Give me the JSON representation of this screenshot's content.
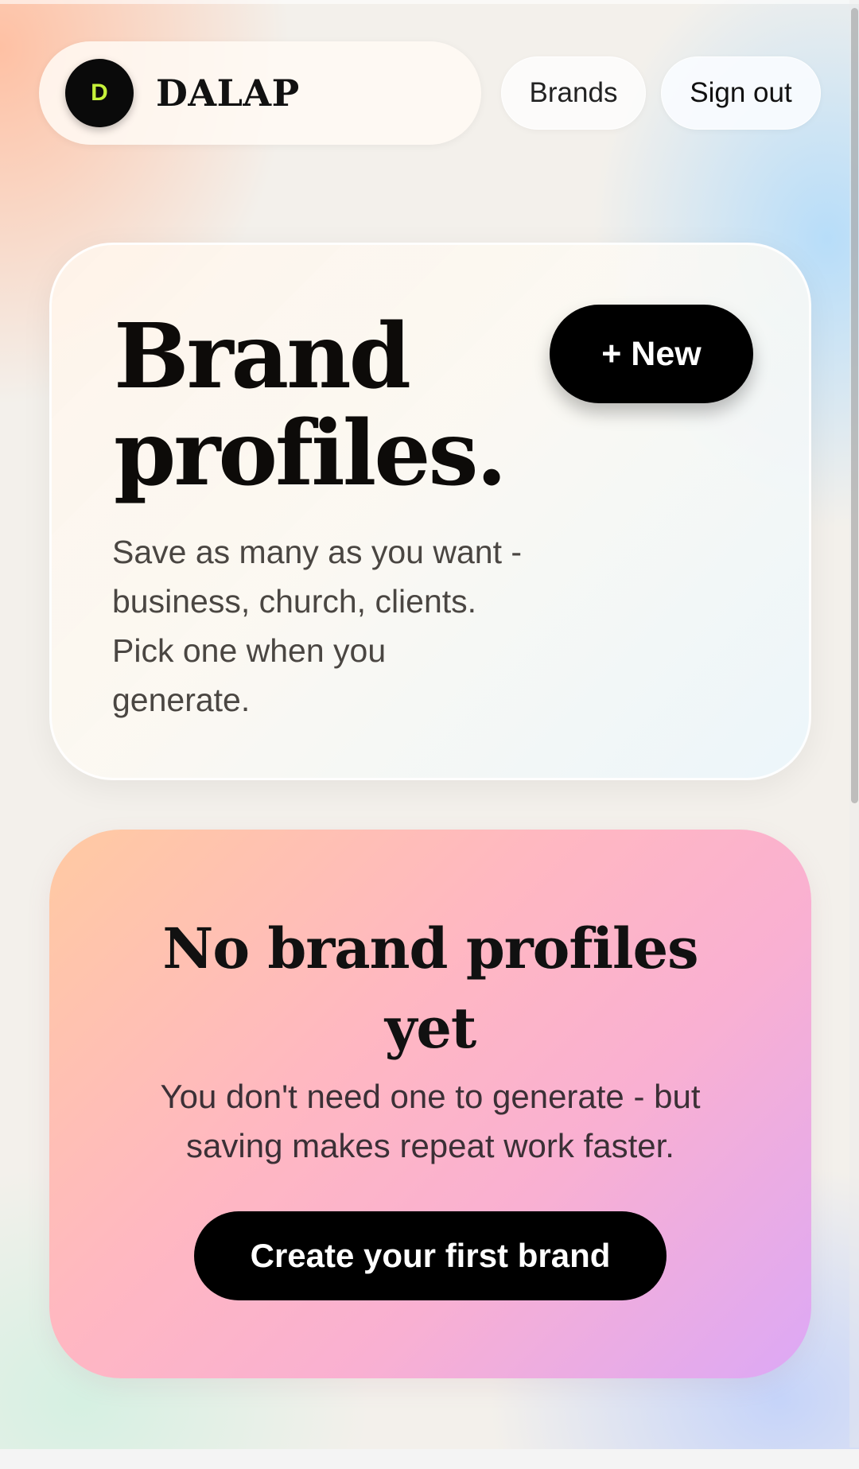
{
  "header": {
    "logo_initial": "D",
    "logo_text": "DALAP",
    "nav": {
      "brands_label": "Brands",
      "signout_label": "Sign out"
    }
  },
  "hero": {
    "title_line1": "Brand",
    "title_line2": "profiles.",
    "description": "Save as many as you want - business, church, clients. Pick one when you generate.",
    "new_button_label": "+ New"
  },
  "empty_state": {
    "title": "No brand profiles yet",
    "description": "You don't need one to generate - but saving makes repeat work faster.",
    "cta_label": "Create your first brand"
  },
  "colors": {
    "logo_accent": "#c6f13a",
    "button_bg": "#000000",
    "button_text": "#ffffff"
  }
}
